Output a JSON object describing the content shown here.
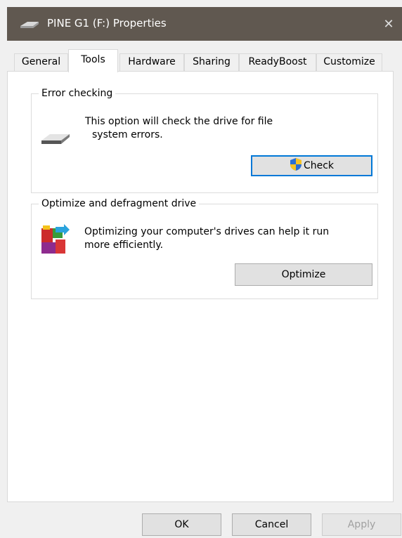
{
  "window": {
    "title": "PINE G1 (F:) Properties",
    "close_glyph": "✕",
    "drive_icon": "drive-icon"
  },
  "tabs": [
    {
      "label": "General"
    },
    {
      "label": "Tools",
      "active": true
    },
    {
      "label": "Hardware"
    },
    {
      "label": "Sharing"
    },
    {
      "label": "ReadyBoost"
    },
    {
      "label": "Customize"
    }
  ],
  "error_checking": {
    "legend": "Error checking",
    "line1": "This option will check the drive for file",
    "line2": "system errors.",
    "button_label": "Check",
    "icons": [
      "hard-drive-icon",
      "shield-icon"
    ]
  },
  "optimize": {
    "legend": "Optimize and defragment drive",
    "line1": "Optimizing your computer's drives can help it run",
    "line2": "more efficiently.",
    "button_label": "Optimize",
    "icon": "defrag-icon"
  },
  "footer": {
    "ok_label": "OK",
    "cancel_label": "Cancel",
    "apply_label": "Apply"
  },
  "colors": {
    "titlebar": "#605850",
    "accent": "#0078d7"
  }
}
